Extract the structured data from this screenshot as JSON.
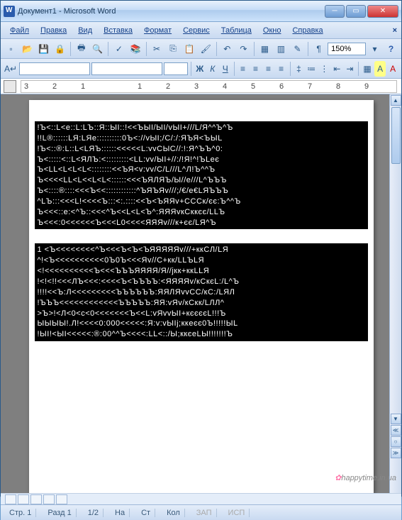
{
  "window": {
    "title": "Документ1 - Microsoft Word"
  },
  "menu": {
    "file": "Файл",
    "edit": "Правка",
    "view": "Вид",
    "insert": "Вставка",
    "format": "Формат",
    "tools": "Сервис",
    "table": "Таблица",
    "window": "Окно",
    "help": "Справка"
  },
  "toolbar": {
    "zoom_value": "150%",
    "pilcrow": "¶",
    "bold": "Ж",
    "italic": "К",
    "underline": "Ч"
  },
  "ruler": {
    "marks": [
      "3",
      "2",
      "1",
      "",
      "1",
      "2",
      "3",
      "4",
      "5",
      "6",
      "7",
      "8",
      "9"
    ]
  },
  "document": {
    "block1_lines": [
      "!Ъ<::L<e::L:LЪ::Я::ЫI::!<<ЪЫI/ЫI/vЫI+///L/Я^^Ъ^Ъ",
      "!!L®::::::LЯ:LЯe::::::::::0Ъ<://vЫI;/C/:/:ЯЪЯ<ЪЫL",
      "!Ъ<::®:L::L<LЯЪ::::::<<<<<L:vvCЫC//:!:Я^ЪЪ^0:",
      "Ъ<:::::<::L<ЯЛЪ:<:::::::::<LL:vv/ЫI+//:/!Я!^!ЪLeє",
      "Ъ<LL<L<L<L<::::::::<<ЪЯ<v:vv/C/L///L^Л!Ъ^^Ъ",
      "Ъ<<<<LL<L<<L<L<::::::<<<ЪЯЛЯЪ/Ы//е///L^ЪЪЪ",
      "Ъ<::::®::::<<<Ъ<<::::::::::::^ЪЯЪЯv///;/€/e€LЯЪЪЪ",
      "^LЪ:::<<<L!<<<<Ъ:::<:.::::<<Ъ<ЪЯЯv+CCCк/єє:Ъ^^Ъ",
      "Ъ<<<::e:<^Ъ::<<<^Ъ<<L<L<Ъ^:ЯЯЯvкCккєє/LLЪ",
      "Ъ<<<:0<<<<<<Ъ<<<L0<<<<ЯЯЯv///к+єє/LЯ^Ъ"
    ],
    "block2_lines": [
      "1 <Ъ<<<<<<<<^Ъ<<<Ъ<Ъ<ЪЯЯЯЯЯv///+ккCЛ/LЯ",
      "^!<Ъ<<<<<<<<<<0Ъ0Ъ<<<Яv//C+кк/LLЪLЯ",
      "<!<<<<<<<<<<Ъ<<<ЪЪЪЯЯЯЯ/Я//jкк+ккLLЯ",
      "!<!<!!<<<ЛЪ<<<:<<<<Ъ<ЪЪЪЪ:<ЯЯЯЯv/кCкєL:/L^Ъ",
      "!!!!<<Ъ:Л<<<<<<<<<ЪЪЪЪЪЪ:ЯЯЛЯvvCC/кC:/LЯЛ",
      "!ЪЪЪ<<<<<<<<<<<<ЪЪЪЪЪ:ЯЯ:vЯv/кCкк/LЛЛ^",
      ">Ъ>!<Л<0<c<0<<<<<<<Ъ<<L:vЯvvЫI+кєєєєL!!!Ъ",
      "ЫЫЫЫ!.Л!<<<<0:000<<<<<:Я:v:vЫIj;ккеєє0Ъ!!!!!ЫL",
      "!ЫI!<ЫI<<<<<:®:00^^Ъ<<<<:LL<::/Ы;ккєeLЫ!!!!!!!Ъ"
    ]
  },
  "status": {
    "page_label": "Стр.",
    "page_val": "1",
    "section_label": "Разд",
    "section_val": "1",
    "pages": "1/2",
    "at_label": "На",
    "at_val": "",
    "line_label": "Ст",
    "line_val": "",
    "col_label": "Кол",
    "col_val": "",
    "rec": "ЗАП",
    "ins": "ИСП"
  },
  "watermark": "happytime.in.ua"
}
